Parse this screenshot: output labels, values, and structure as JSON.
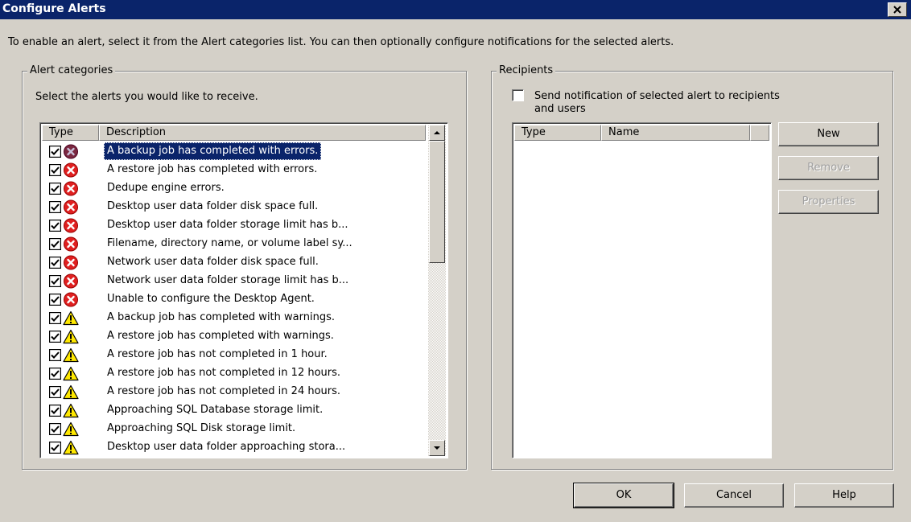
{
  "window": {
    "title": "Configure Alerts",
    "close_glyph": "×",
    "instructions": "To enable an alert, select it from the Alert categories list. You can then optionally configure notifications for the selected alerts."
  },
  "alert_categories": {
    "group_label": "Alert categories",
    "prompt": "Select the alerts you would like to receive.",
    "columns": [
      "Type",
      "Description"
    ],
    "items": [
      {
        "type": "error",
        "checked": true,
        "description": "A backup job has completed with errors.",
        "selected": true
      },
      {
        "type": "error",
        "checked": true,
        "description": "A restore job has completed with errors."
      },
      {
        "type": "error",
        "checked": true,
        "description": "Dedupe engine errors."
      },
      {
        "type": "error",
        "checked": true,
        "description": "Desktop user data folder disk space full."
      },
      {
        "type": "error",
        "checked": true,
        "description": "Desktop user data folder storage limit has b..."
      },
      {
        "type": "error",
        "checked": true,
        "description": "Filename, directory name, or volume label sy..."
      },
      {
        "type": "error",
        "checked": true,
        "description": "Network user data folder disk space full."
      },
      {
        "type": "error",
        "checked": true,
        "description": "Network user data folder storage limit has b..."
      },
      {
        "type": "error",
        "checked": true,
        "description": "Unable to configure the Desktop Agent."
      },
      {
        "type": "warning",
        "checked": true,
        "description": "A backup job has completed with warnings."
      },
      {
        "type": "warning",
        "checked": true,
        "description": "A restore job has completed with warnings."
      },
      {
        "type": "warning",
        "checked": true,
        "description": "A restore job has not completed in 1 hour."
      },
      {
        "type": "warning",
        "checked": true,
        "description": "A restore job has not completed in 12 hours."
      },
      {
        "type": "warning",
        "checked": true,
        "description": "A restore job has not completed in 24 hours."
      },
      {
        "type": "warning",
        "checked": true,
        "description": "Approaching SQL Database storage limit."
      },
      {
        "type": "warning",
        "checked": true,
        "description": "Approaching SQL Disk storage limit."
      },
      {
        "type": "warning",
        "checked": true,
        "description": "Desktop user data folder approaching stora..."
      }
    ]
  },
  "recipients": {
    "group_label": "Recipients",
    "send_notification_line1": "Send notification of selected alert to recipients",
    "send_notification_line2": "and users",
    "send_notification_checked": false,
    "columns": [
      "Type",
      "Name"
    ],
    "buttons": {
      "new": "New",
      "remove": "Remove",
      "properties": "Properties"
    }
  },
  "footer": {
    "ok": "OK",
    "cancel": "Cancel",
    "help": "Help"
  },
  "colors": {
    "title_bar": "#0a246a",
    "dialog_bg": "#d4d0c8",
    "selection": "#0a246a",
    "error_red": "#e02020",
    "warning_yellow": "#ffe800"
  },
  "icons": {
    "error": "error-x-icon",
    "warning": "warning-triangle-icon",
    "check": "checkbox-checked-icon"
  }
}
